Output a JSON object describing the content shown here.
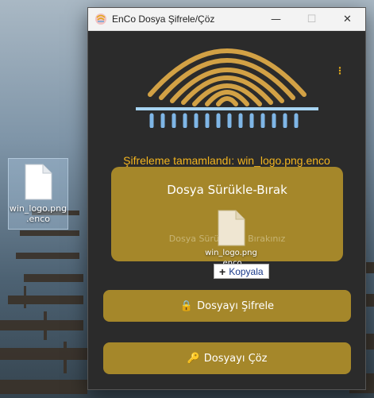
{
  "desktop": {
    "icon": {
      "name": "win_logo.png\n.enco",
      "icon": "file-icon"
    }
  },
  "window": {
    "title": "EnCo Dosya Şifrele/Çöz",
    "controls": {
      "minimize": "—",
      "maximize": "☐",
      "close": "✕"
    }
  },
  "app": {
    "menu_icon": "⋮",
    "status": "Şifreleme tamamlandı: win_logo.png.enco",
    "dropzone": {
      "title": "Dosya Sürükle-Bırak",
      "subtitle": "Dosya Sürükleyip Bırakınız"
    },
    "drag_ghost": {
      "name": "win_logo.png\n.enco"
    },
    "copy_tooltip": {
      "plus": "+",
      "label": "Kopyala"
    },
    "buttons": {
      "encrypt": {
        "icon": "🔒",
        "label": "Dosyayı Şifrele"
      },
      "decrypt": {
        "icon": "🔑",
        "label": "Dosyayı Çöz"
      }
    }
  },
  "colors": {
    "accent": "#f3b51f",
    "button_bg": "#a5872a",
    "window_bg": "#2b2b2b"
  }
}
